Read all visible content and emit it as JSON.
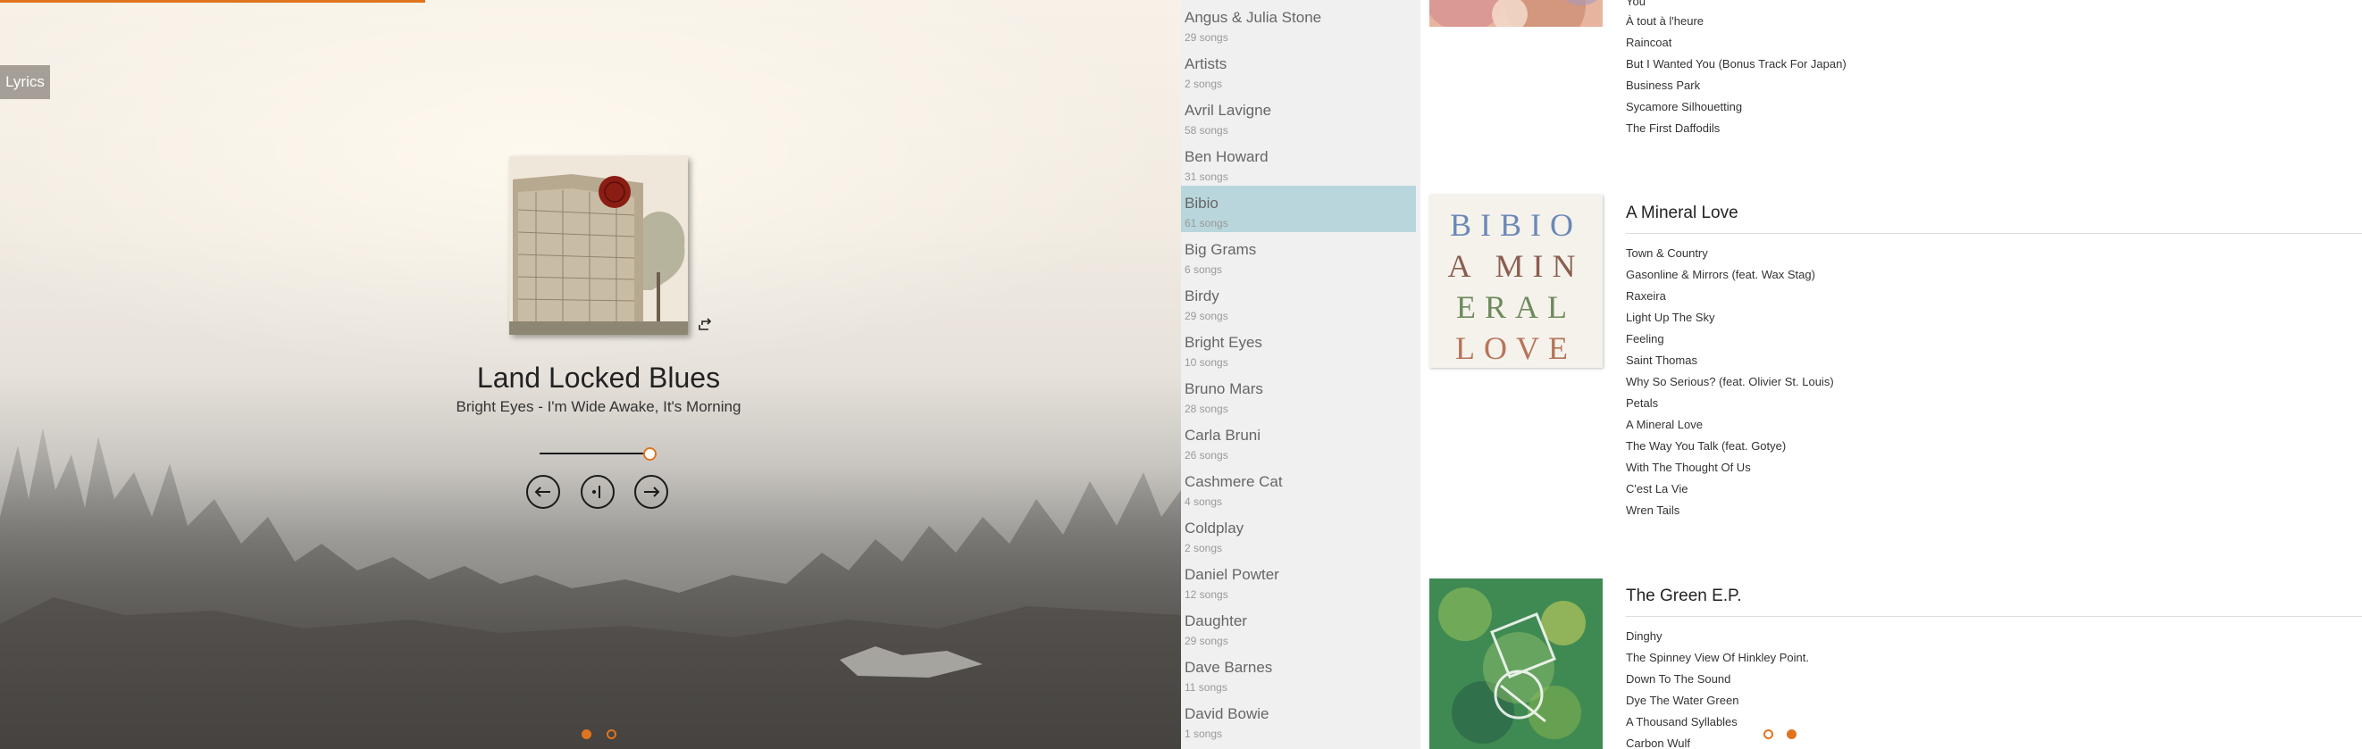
{
  "player": {
    "lyrics_label": "Lyrics",
    "track_title": "Land Locked Blues",
    "track_subtitle": "Bright Eyes - I'm Wide Awake, It's Morning",
    "seek_fraction": 0.95,
    "playback_progress_fraction": 0.18,
    "accent_color": "#e0741e",
    "page_dots": [
      {
        "active": true
      },
      {
        "active": false
      }
    ]
  },
  "artists": [
    {
      "name": "Angus & Julia Stone",
      "count": "29 songs"
    },
    {
      "name": "Artists",
      "count": "2 songs"
    },
    {
      "name": "Avril Lavigne",
      "count": "58 songs"
    },
    {
      "name": "Ben Howard",
      "count": "31 songs"
    },
    {
      "name": "Bibio",
      "count": "61 songs",
      "selected": true
    },
    {
      "name": "Big Grams",
      "count": "6 songs"
    },
    {
      "name": "Birdy",
      "count": "29 songs"
    },
    {
      "name": "Bright Eyes",
      "count": "10 songs"
    },
    {
      "name": "Bruno Mars",
      "count": "28 songs"
    },
    {
      "name": "Carla Bruni",
      "count": "26 songs"
    },
    {
      "name": "Cashmere Cat",
      "count": "4 songs"
    },
    {
      "name": "Coldplay",
      "count": "2 songs"
    },
    {
      "name": "Daniel Powter",
      "count": "12 songs"
    },
    {
      "name": "Daughter",
      "count": "29 songs"
    },
    {
      "name": "Dave Barnes",
      "count": "11 songs"
    },
    {
      "name": "David Bowie",
      "count": "1 songs"
    }
  ],
  "albums": [
    {
      "title": "",
      "songs": [
        "You",
        "À tout à l'heure",
        "Raincoat",
        "But I Wanted You (Bonus Track For Japan)",
        "Business Park",
        "Sycamore Silhouetting",
        "The First Daffodils"
      ]
    },
    {
      "title": "A Mineral Love",
      "art_text": [
        "BIBIO",
        "A MIN",
        "ERAL",
        "LOVE"
      ],
      "songs": [
        "Town & Country",
        "Gasonline & Mirrors (feat. Wax Stag)",
        "Raxeira",
        "Light Up The Sky",
        "Feeling",
        "Saint Thomas",
        "Why So Serious? (feat. Olivier St. Louis)",
        "Petals",
        "A Mineral Love",
        "The Way You Talk (feat. Gotye)",
        "With The Thought Of Us",
        "C'est La Vie",
        "Wren Tails"
      ]
    },
    {
      "title": "The Green E.P.",
      "songs": [
        "Dinghy",
        "The Spinney View Of Hinkley Point.",
        "Down To The Sound",
        "Dye The Water Green",
        "A Thousand Syllables",
        "Carbon Wulf"
      ]
    }
  ],
  "album_dots": [
    {
      "active": false
    },
    {
      "active": true
    }
  ]
}
